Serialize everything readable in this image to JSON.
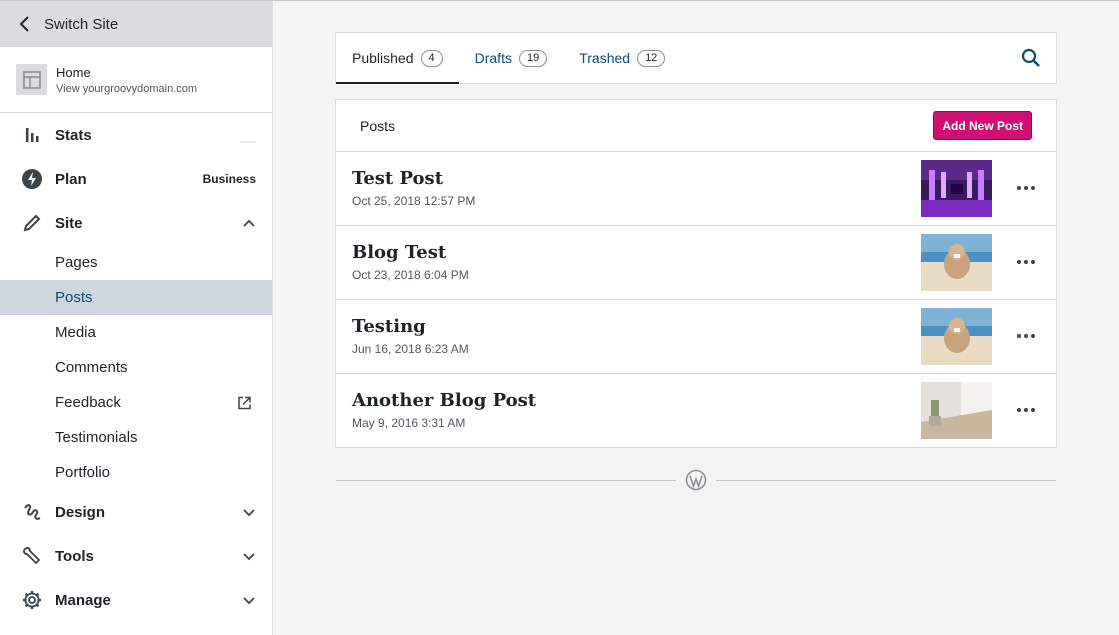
{
  "sidebar": {
    "switch_site": "Switch Site",
    "site": {
      "name": "Home",
      "url": "View yourgroovydomain.com"
    },
    "nav": {
      "stats": {
        "label": "Stats",
        "icon": "stats-icon"
      },
      "plan": {
        "label": "Plan",
        "badge": "Business",
        "icon": "plan-icon"
      },
      "site": {
        "label": "Site",
        "icon": "pencil-icon"
      },
      "design": {
        "label": "Design",
        "icon": "design-icon"
      },
      "tools": {
        "label": "Tools",
        "icon": "wrench-icon"
      },
      "manage": {
        "label": "Manage",
        "icon": "gear-icon"
      }
    },
    "sub_items": [
      {
        "label": "Pages"
      },
      {
        "label": "Posts",
        "active": true
      },
      {
        "label": "Media"
      },
      {
        "label": "Comments"
      },
      {
        "label": "Feedback",
        "external": true
      },
      {
        "label": "Testimonials"
      },
      {
        "label": "Portfolio"
      }
    ]
  },
  "tabs": [
    {
      "label": "Published",
      "count": "4",
      "active": true
    },
    {
      "label": "Drafts",
      "count": "19"
    },
    {
      "label": "Trashed",
      "count": "12"
    }
  ],
  "posts": {
    "header_title": "Posts",
    "add_button": "Add New Post",
    "items": [
      {
        "title": "Test Post",
        "date": "Oct 25, 2018 12:57 PM",
        "thumb": "purple-room"
      },
      {
        "title": "Blog Test",
        "date": "Oct 23, 2018 6:04 PM",
        "thumb": "dog-beach"
      },
      {
        "title": "Testing",
        "date": "Jun 16, 2018 6:23 AM",
        "thumb": "dog-beach"
      },
      {
        "title": "Another Blog Post",
        "date": "May 9, 2016 3:31 AM",
        "thumb": "desk-plant"
      }
    ]
  },
  "colors": {
    "accent": "#d30e72",
    "link": "#0a4b78",
    "active_bg": "#d0d6dd"
  }
}
